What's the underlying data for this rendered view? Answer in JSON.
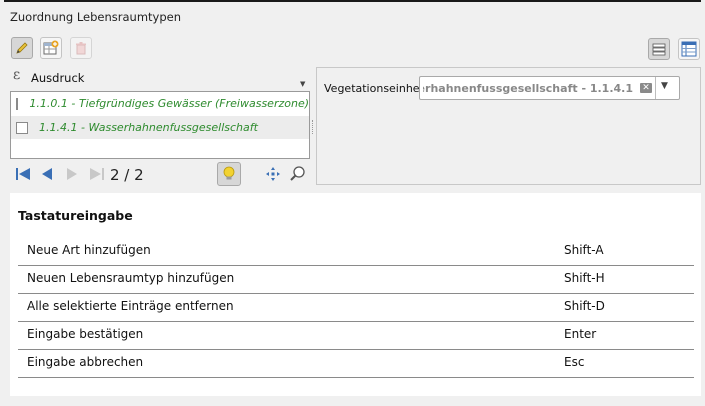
{
  "group": {
    "title": "Zuordnung Lebensraumtypen"
  },
  "toolbar": {
    "icons": [
      "pencil-icon",
      "add-table-icon",
      "delete-icon",
      "form-view-icon",
      "table-view-icon"
    ]
  },
  "expression": {
    "label": "Ausdruck",
    "icon": "ε"
  },
  "list": {
    "items": [
      {
        "label": "1.1.0.1 - Tiefgründiges Gewässer (Freiwasserzone)",
        "checked": false
      },
      {
        "label": "1.1.4.1 - Wasserhahnenfussgesellschaft",
        "checked": false
      }
    ]
  },
  "navigation": {
    "page_counter": "2 / 2"
  },
  "vegetation": {
    "label": "Vegetationseinheit",
    "value": "1.1.4.1 - Wasserhahnenfussgesellschaft"
  },
  "help": {
    "title": "Tastatureingabe",
    "rows": [
      {
        "action": "Neue Art hinzufügen",
        "key": "Shift-A"
      },
      {
        "action": "Neuen Lebensraumtyp hinzufügen",
        "key": "Shift-H"
      },
      {
        "action": "Alle selektierte Einträge entfernen",
        "key": "Shift-D"
      },
      {
        "action": "Eingabe bestätigen",
        "key": "Enter"
      },
      {
        "action": "Eingabe abbrechen",
        "key": "Esc"
      }
    ]
  },
  "colors": {
    "list_text": "#2e8b2e",
    "nav_blue": "#3a6fb5",
    "lightbulb": "#f2d230"
  }
}
